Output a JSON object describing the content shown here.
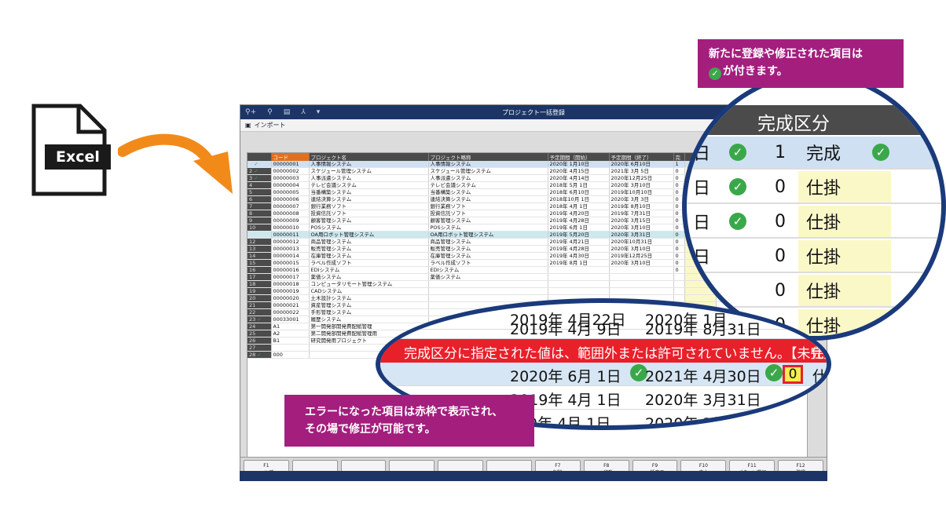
{
  "excel_label": "Excel",
  "window": {
    "title": "プロジェクト一括登録",
    "import_label": "インポート",
    "columns": [
      "コード",
      "プロジェクト名",
      "プロジェクト略称",
      "予定期間（開始）",
      "予定期間（終了）",
      "完"
    ],
    "rows": [
      {
        "no": "1",
        "chk": true,
        "code": "00000001",
        "name": "人事情報システム",
        "abbr": "人事情報システム",
        "start": "2020年 1月10日",
        "end": "2020年 6月10日",
        "k": "1"
      },
      {
        "no": "2",
        "chk": true,
        "code": "00000002",
        "name": "スケジュール管理システム",
        "abbr": "スケジュール管理システム",
        "start": "2020年 4月15日",
        "end": "2021年 3月 5日",
        "k": "0"
      },
      {
        "no": "3",
        "chk": true,
        "code": "00000003",
        "name": "人事派遣システム",
        "abbr": "人事派遣システム",
        "start": "2020年 4月14日",
        "end": "2020年12月25日",
        "k": "0"
      },
      {
        "no": "4",
        "chk": false,
        "code": "00000004",
        "name": "テレビ会議システム",
        "abbr": "テレビ会議システム",
        "start": "2018年 5月 1日",
        "end": "2020年 3月10日",
        "k": "0"
      },
      {
        "no": "5",
        "chk": false,
        "code": "00000005",
        "name": "当番構築システム",
        "abbr": "当番構築システム",
        "start": "2018年 6月10日",
        "end": "2019年10月10日",
        "k": "0"
      },
      {
        "no": "6",
        "chk": false,
        "code": "00000006",
        "name": "連結決算システム",
        "abbr": "連結決算システム",
        "start": "2018年10月 1日",
        "end": "2020年 3月 3日",
        "k": "0"
      },
      {
        "no": "7",
        "chk": false,
        "code": "00000007",
        "name": "銀行業務ソフト",
        "abbr": "銀行業務ソフト",
        "start": "2018年 4月 1日",
        "end": "2019年 8月10日",
        "k": "0"
      },
      {
        "no": "8",
        "chk": false,
        "code": "00000008",
        "name": "投資信託ソフト",
        "abbr": "投資信託ソフト",
        "start": "2019年 4月20日",
        "end": "2019年 7月31日",
        "k": "0"
      },
      {
        "no": "9",
        "chk": false,
        "code": "00000009",
        "name": "顧客管理システム",
        "abbr": "顧客管理システム",
        "start": "2019年 4月28日",
        "end": "2020年 3月15日",
        "k": "0"
      },
      {
        "no": "10",
        "chk": false,
        "code": "00000010",
        "name": "POSシステム",
        "abbr": "POSシステム",
        "start": "2019年 6月 1日",
        "end": "2020年 3月10日",
        "k": "0"
      },
      {
        "no": "11",
        "chk": false,
        "code": "00000011",
        "name": "OA用ロボット管理システム",
        "abbr": "OA用ロボット管理システム",
        "start": "2019年 5月20日",
        "end": "2020年 3月31日",
        "k": "0"
      },
      {
        "no": "12",
        "chk": false,
        "code": "00000012",
        "name": "商品管理システム",
        "abbr": "商品管理システム",
        "start": "2019年 4月21日",
        "end": "2020年10月31日",
        "k": "0"
      },
      {
        "no": "13",
        "chk": false,
        "code": "00000013",
        "name": "販売管理システム",
        "abbr": "販売管理システム",
        "start": "2019年 4月28日",
        "end": "2020年 3月10日",
        "k": "0"
      },
      {
        "no": "14",
        "chk": false,
        "code": "00000014",
        "name": "在庫管理システム",
        "abbr": "在庫管理システム",
        "start": "2019年 4月30日",
        "end": "2019年12月25日",
        "k": "0"
      },
      {
        "no": "15",
        "chk": false,
        "code": "00000015",
        "name": "ラベル作成ソフト",
        "abbr": "ラベル作成ソフト",
        "start": "2019年 8月 1日",
        "end": "2020年 3月10日",
        "k": "0"
      },
      {
        "no": "16",
        "chk": false,
        "code": "00000016",
        "name": "EDIシステム",
        "abbr": "EDIシステム",
        "start": "",
        "end": "",
        "k": "0"
      },
      {
        "no": "17",
        "chk": false,
        "code": "00000017",
        "name": "薬価システム",
        "abbr": "薬価システム",
        "start": "",
        "end": "",
        "k": ""
      },
      {
        "no": "18",
        "chk": false,
        "code": "00000018",
        "name": "コンピュータリモート管理システム",
        "abbr": "",
        "start": "",
        "end": "",
        "k": ""
      },
      {
        "no": "19",
        "chk": false,
        "code": "00000019",
        "name": "CADシステム",
        "abbr": "",
        "start": "",
        "end": "",
        "k": ""
      },
      {
        "no": "20",
        "chk": false,
        "code": "00000020",
        "name": "土木設計システム",
        "abbr": "",
        "start": "",
        "end": "",
        "k": ""
      },
      {
        "no": "21",
        "chk": false,
        "code": "00000021",
        "name": "資産管理システム",
        "abbr": "",
        "start": "",
        "end": "",
        "k": ""
      },
      {
        "no": "22",
        "chk": false,
        "code": "00000022",
        "name": "手形管理システム",
        "abbr": "",
        "start": "",
        "end": "",
        "k": ""
      },
      {
        "no": "23",
        "chk": true,
        "code": "00033001",
        "name": "履歴システム",
        "abbr": "",
        "start": "",
        "end": "",
        "k": ""
      },
      {
        "no": "24",
        "chk": false,
        "code": "A1",
        "name": "第一開発部開発費配賦管理",
        "abbr": "",
        "start": "",
        "end": "",
        "k": ""
      },
      {
        "no": "25",
        "chk": false,
        "code": "A2",
        "name": "第二開発部開発費配賦管理用",
        "abbr": "",
        "start": "",
        "end": "",
        "k": ""
      },
      {
        "no": "26",
        "chk": false,
        "code": "B1",
        "name": "研究開発用プロジェクト",
        "abbr": "",
        "start": "",
        "end": "",
        "k": ""
      },
      {
        "no": "27",
        "chk": false,
        "code": "",
        "name": "",
        "abbr": "",
        "start": "",
        "end": "",
        "k": ""
      },
      {
        "no": "28",
        "chk": true,
        "code": "000",
        "name": "",
        "abbr": "",
        "start": "",
        "end": "",
        "k": ""
      }
    ],
    "right_snippets": [
      "11.00 2020年 3月31日",
      "7.00 2020年 8月31日",
      "2020年12月31日",
      "9.00",
      "33.00",
      "年 月 日"
    ],
    "function_keys": [
      {
        "key": "F1",
        "label": "ヘルプ"
      },
      {
        "key": "",
        "label": ""
      },
      {
        "key": "",
        "label": ""
      },
      {
        "key": "",
        "label": ""
      },
      {
        "key": "",
        "label": ""
      },
      {
        "key": "",
        "label": ""
      },
      {
        "key": "F7",
        "label": "削除"
      },
      {
        "key": "F8",
        "label": "↓移動"
      },
      {
        "key": "F9",
        "label": "一括変更"
      },
      {
        "key": "F10",
        "label": "中止"
      },
      {
        "key": "F11",
        "label": "パターン選択"
      },
      {
        "key": "F12",
        "label": "登録"
      }
    ]
  },
  "zoom_top": {
    "header": "完成区分",
    "rows": [
      {
        "day": "日",
        "chk": true,
        "val": "1",
        "text": "完成"
      },
      {
        "day": "日",
        "chk": true,
        "val": "0",
        "text": "仕掛"
      },
      {
        "day": "日",
        "chk": true,
        "val": "0",
        "text": "仕掛"
      },
      {
        "day": "日",
        "chk": false,
        "val": "0",
        "text": "仕掛"
      },
      {
        "day": "",
        "chk": false,
        "val": "0",
        "text": "仕掛"
      },
      {
        "day": "",
        "chk": false,
        "val": "0",
        "text": "仕掛"
      }
    ]
  },
  "zoom_bottom": {
    "row1": {
      "start": "2019年 4月22日",
      "end": "2020年 1月"
    },
    "row2": {
      "start": "2019年 4月 9日",
      "end": "2019年 8月31日"
    },
    "error": "完成区分に指定された値は、範囲外または許可されていません。【未完成】",
    "error_tail": "仕",
    "row3": {
      "start": "2020年 6月 1日",
      "end": "2021年 4月30日",
      "val": "0",
      "tail": "仕"
    },
    "row4": {
      "start": "2019年 4月 1日",
      "end": "2020年 3月31日",
      "tail": "日"
    },
    "row5": {
      "start": "9年 4月 1日",
      "end": "2020年 3月"
    }
  },
  "callout_top": {
    "line1": "新たに登録や修正された項目は",
    "line2": "が付きます。"
  },
  "callout_bottom": {
    "line1": "エラーになった項目は赤枠で表示され、",
    "line2": "その場で修正が可能です。"
  }
}
